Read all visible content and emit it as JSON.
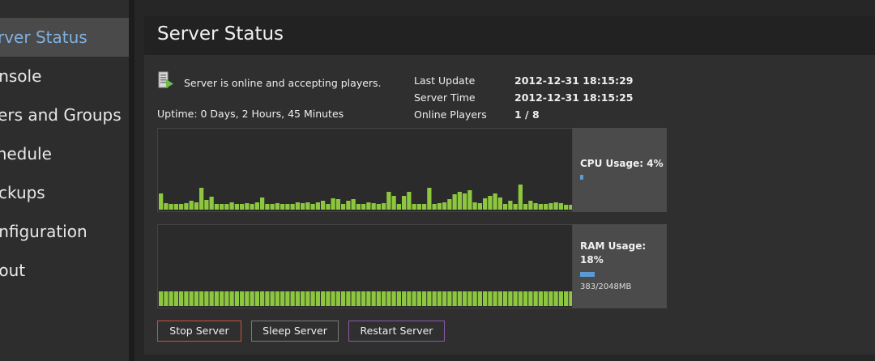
{
  "sidebar": {
    "items": [
      {
        "label": "Server Status",
        "active": true
      },
      {
        "label": "Console"
      },
      {
        "label": "Users and Groups"
      },
      {
        "label": "Schedule"
      },
      {
        "label": "Backups"
      },
      {
        "label": "Configuration"
      },
      {
        "label": "About"
      }
    ]
  },
  "panel": {
    "title": "Server Status",
    "status_text": "Server is online and accepting players.",
    "uptime": "Uptime: 0 Days, 2 Hours, 45 Minutes",
    "info": [
      {
        "label": "Last Update",
        "value": "2012-12-31  18:15:29"
      },
      {
        "label": "Server Time",
        "value": "2012-12-31  18:15:25"
      },
      {
        "label": "Online Players",
        "value": "1 / 8"
      }
    ]
  },
  "cpu": {
    "label": "CPU Usage: 4%",
    "percent": 4,
    "history": [
      20,
      8,
      7,
      7,
      7,
      8,
      11,
      9,
      27,
      12,
      16,
      7,
      7,
      7,
      9,
      7,
      7,
      8,
      7,
      9,
      15,
      7,
      7,
      8,
      7,
      7,
      7,
      9,
      8,
      9,
      7,
      9,
      11,
      7,
      14,
      13,
      7,
      11,
      13,
      7,
      7,
      9,
      8,
      7,
      8,
      22,
      17,
      7,
      17,
      22,
      7,
      7,
      7,
      27,
      7,
      8,
      9,
      13,
      19,
      22,
      20,
      24,
      9,
      8,
      14,
      17,
      20,
      15,
      7,
      11,
      7,
      31,
      7,
      11,
      8,
      7,
      7,
      8,
      9,
      8,
      6,
      6
    ]
  },
  "ram": {
    "label_line1": "RAM Usage:",
    "label_line2": "18%",
    "percent": 18,
    "detail": "383/2048MB",
    "history": [
      18,
      18,
      18,
      18,
      18,
      18,
      18,
      18,
      18,
      18,
      18,
      18,
      18,
      18,
      18,
      18,
      18,
      18,
      18,
      18,
      18,
      18,
      18,
      18,
      18,
      18,
      18,
      18,
      18,
      18,
      18,
      18,
      18,
      18,
      18,
      18,
      18,
      18,
      18,
      18,
      18,
      18,
      18,
      18,
      18,
      18,
      18,
      18,
      18,
      18,
      18,
      18,
      18,
      18,
      18,
      18,
      18,
      18,
      18,
      18,
      18,
      18,
      18,
      18,
      18,
      18,
      18,
      18,
      18,
      18,
      18,
      18,
      18,
      18,
      18,
      18,
      18,
      18,
      18,
      18,
      18,
      18
    ]
  },
  "buttons": {
    "stop": "Stop Server",
    "sleep": "Sleep Server",
    "restart": "Restart Server"
  },
  "colors": {
    "bar": "#8dc63f",
    "accent": "#5a9bd5",
    "stop_border": "#d0533b",
    "restart_border": "#8a5aa8"
  }
}
